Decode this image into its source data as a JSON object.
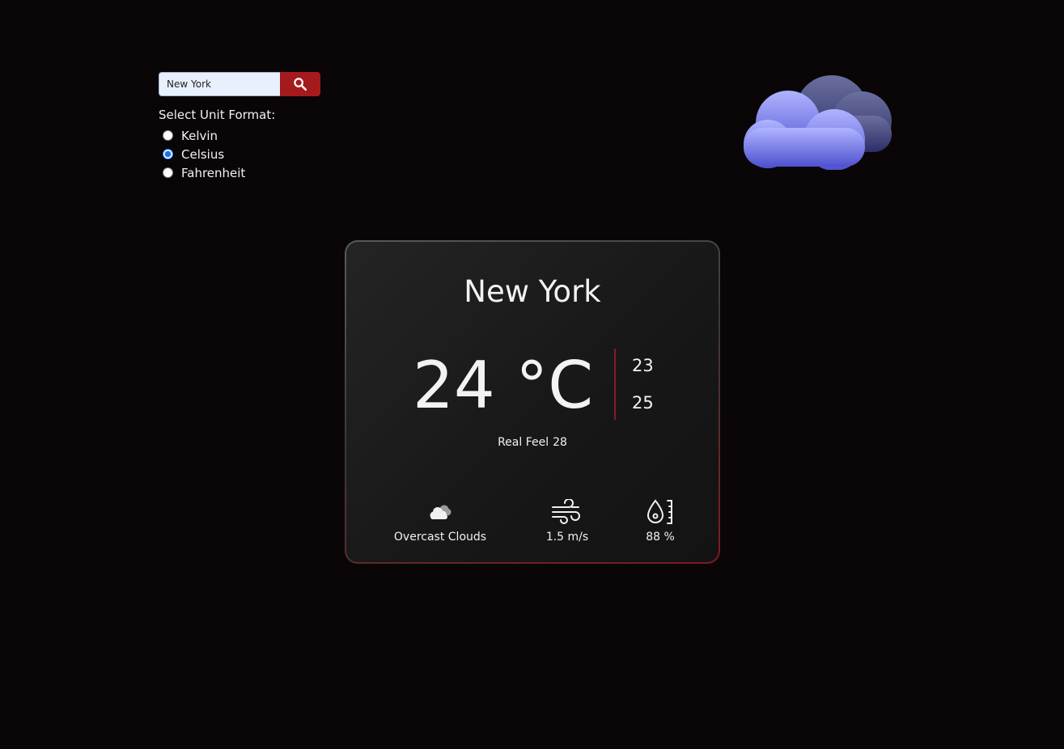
{
  "search": {
    "value": "New York",
    "icon": "search-icon",
    "button_color": "#a51a1c"
  },
  "units": {
    "title": "Select Unit Format:",
    "options": [
      "Kelvin",
      "Celsius",
      "Fahrenheit"
    ],
    "selected": "Celsius"
  },
  "weather": {
    "city": "New York",
    "temp": "24 °C",
    "temp_min": "23",
    "temp_max": "25",
    "real_feel_label": "Real Feel",
    "real_feel_value": "28",
    "description": "Overcast Clouds",
    "wind": "1.5 m/s",
    "humidity": "88 %",
    "hero_icon": "overcast-cloud-icon",
    "stat_icons": [
      "cloud-icon",
      "wind-icon",
      "humidity-icon"
    ]
  },
  "colors": {
    "background": "#0a0608",
    "accent": "#a51a1c",
    "cloud": "#8c8ff0"
  }
}
